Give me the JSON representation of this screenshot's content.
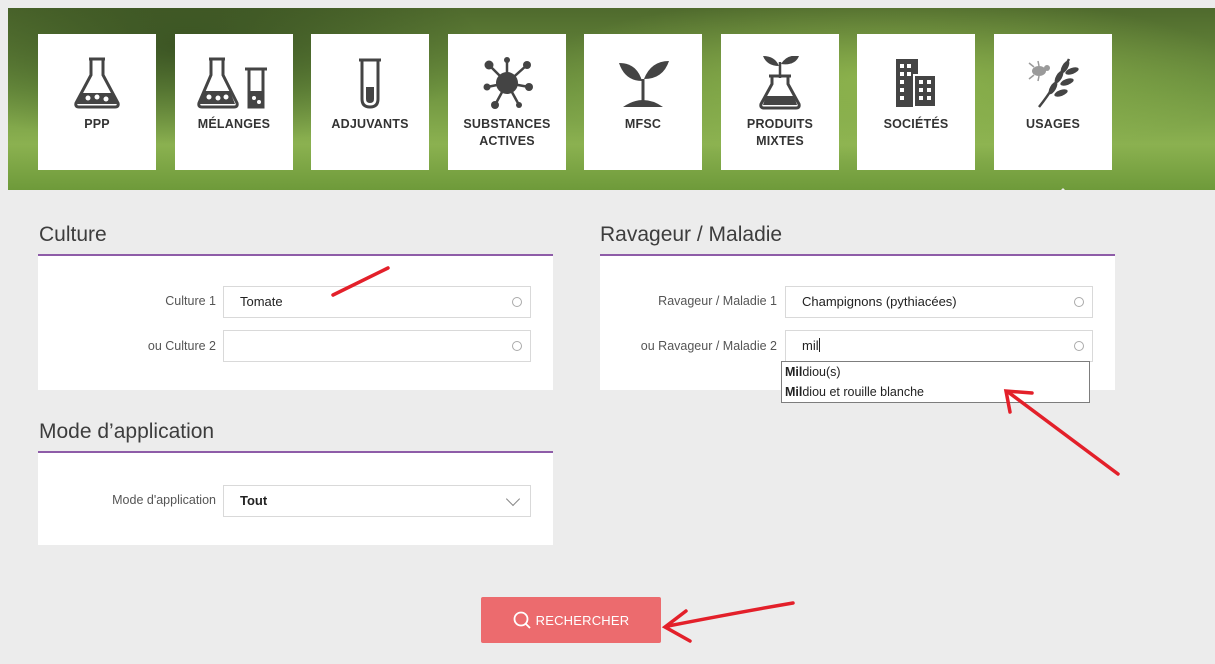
{
  "nav": {
    "tiles": [
      {
        "label": "PPP",
        "icon": "flask-icon"
      },
      {
        "label": "MÉLANGES",
        "icon": "flasks-icon"
      },
      {
        "label": "ADJUVANTS",
        "icon": "test-tube-icon"
      },
      {
        "label_line1": "SUBSTANCES",
        "label_line2": "ACTIVES",
        "icon": "molecule-icon"
      },
      {
        "label": "MFSC",
        "icon": "sprout-icon"
      },
      {
        "label_line1": "PRODUITS",
        "label_line2": "MIXTES",
        "icon": "plant-flask-icon"
      },
      {
        "label": "SOCIÉTÉS",
        "icon": "buildings-icon"
      },
      {
        "label": "USAGES",
        "icon": "wheat-bug-icon"
      }
    ],
    "active_tile": "USAGES"
  },
  "culture": {
    "title": "Culture",
    "field1_label": "Culture 1",
    "field1_value": "Tomate",
    "field2_label": "ou Culture 2",
    "field2_value": ""
  },
  "ravageur": {
    "title": "Ravageur / Maladie",
    "field1_label": "Ravageur / Maladie 1",
    "field1_value": "Champignons (pythiacées)",
    "field2_label": "ou Ravageur / Maladie 2",
    "field2_value": "mil",
    "suggestions": [
      {
        "match": "Mil",
        "rest": "diou(s)"
      },
      {
        "match": "Mil",
        "rest": "diou et rouille blanche"
      }
    ]
  },
  "mode": {
    "title": "Mode d’application",
    "label": "Mode d'application",
    "value": "Tout"
  },
  "search_button": {
    "label": "RECHERCHER"
  },
  "colors": {
    "accent_purple": "#8e5ca8",
    "button_red": "#ec6b6e",
    "annotation_red": "#e3202a"
  }
}
